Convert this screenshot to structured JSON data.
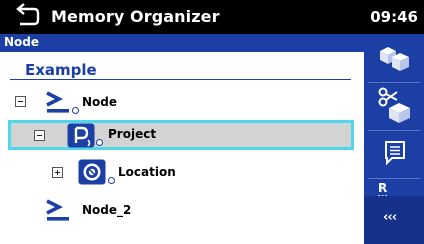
{
  "titlebar": {
    "title": "Memory Organizer",
    "time": "09:46",
    "back_icon": "return-arrow-icon"
  },
  "breadcrumb": {
    "text": "Node"
  },
  "tree": {
    "heading": "Example",
    "items": [
      {
        "label": "Node",
        "icon": "node-prompt-icon",
        "expanded": true
      },
      {
        "label": "Project",
        "icon": "project-icon",
        "expanded": true,
        "selected": true
      },
      {
        "label": "Location",
        "icon": "location-icon",
        "expanded": false
      },
      {
        "label": "Node_2",
        "icon": "node-prompt-icon"
      }
    ]
  },
  "sidebar": {
    "buttons": [
      {
        "name": "add-structure",
        "icon": "add-structure-icon"
      },
      {
        "name": "cut",
        "icon": "scissors-icon"
      },
      {
        "name": "comment",
        "icon": "comment-icon"
      },
      {
        "name": "rename",
        "icon": "rename-icon",
        "letter": "R"
      },
      {
        "name": "more",
        "icon": "triple-chevron-left-icon",
        "label": "‹‹‹"
      }
    ]
  },
  "colors": {
    "accent": "#1b3fa5",
    "selection_border": "#4fd8ec",
    "selection_bg": "#d3d3d3"
  }
}
